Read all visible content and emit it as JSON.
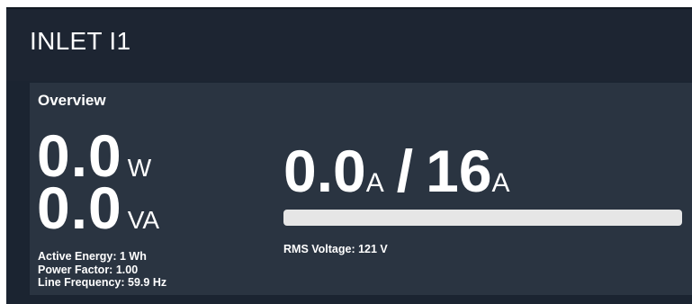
{
  "inlet": {
    "title": "INLET I1"
  },
  "overview": {
    "title": "Overview",
    "active_power": {
      "value": "0.0",
      "unit": "W"
    },
    "apparent_power": {
      "value": "0.0",
      "unit": "VA"
    },
    "stats": {
      "active_energy": "Active Energy: 1 Wh",
      "power_factor": "Power Factor: 1.00",
      "line_frequency": "Line Frequency: 59.9 Hz"
    },
    "current": {
      "value": "0.0",
      "unit": "A",
      "separator": "/",
      "rated": "16",
      "rated_unit": "A",
      "fraction": 0.0
    },
    "rms_voltage": "RMS Voltage: 121 V"
  },
  "colors": {
    "background": "#1b2431",
    "panel": "#2a3441",
    "bar_track": "#e6e6e6",
    "text": "#ffffff"
  }
}
